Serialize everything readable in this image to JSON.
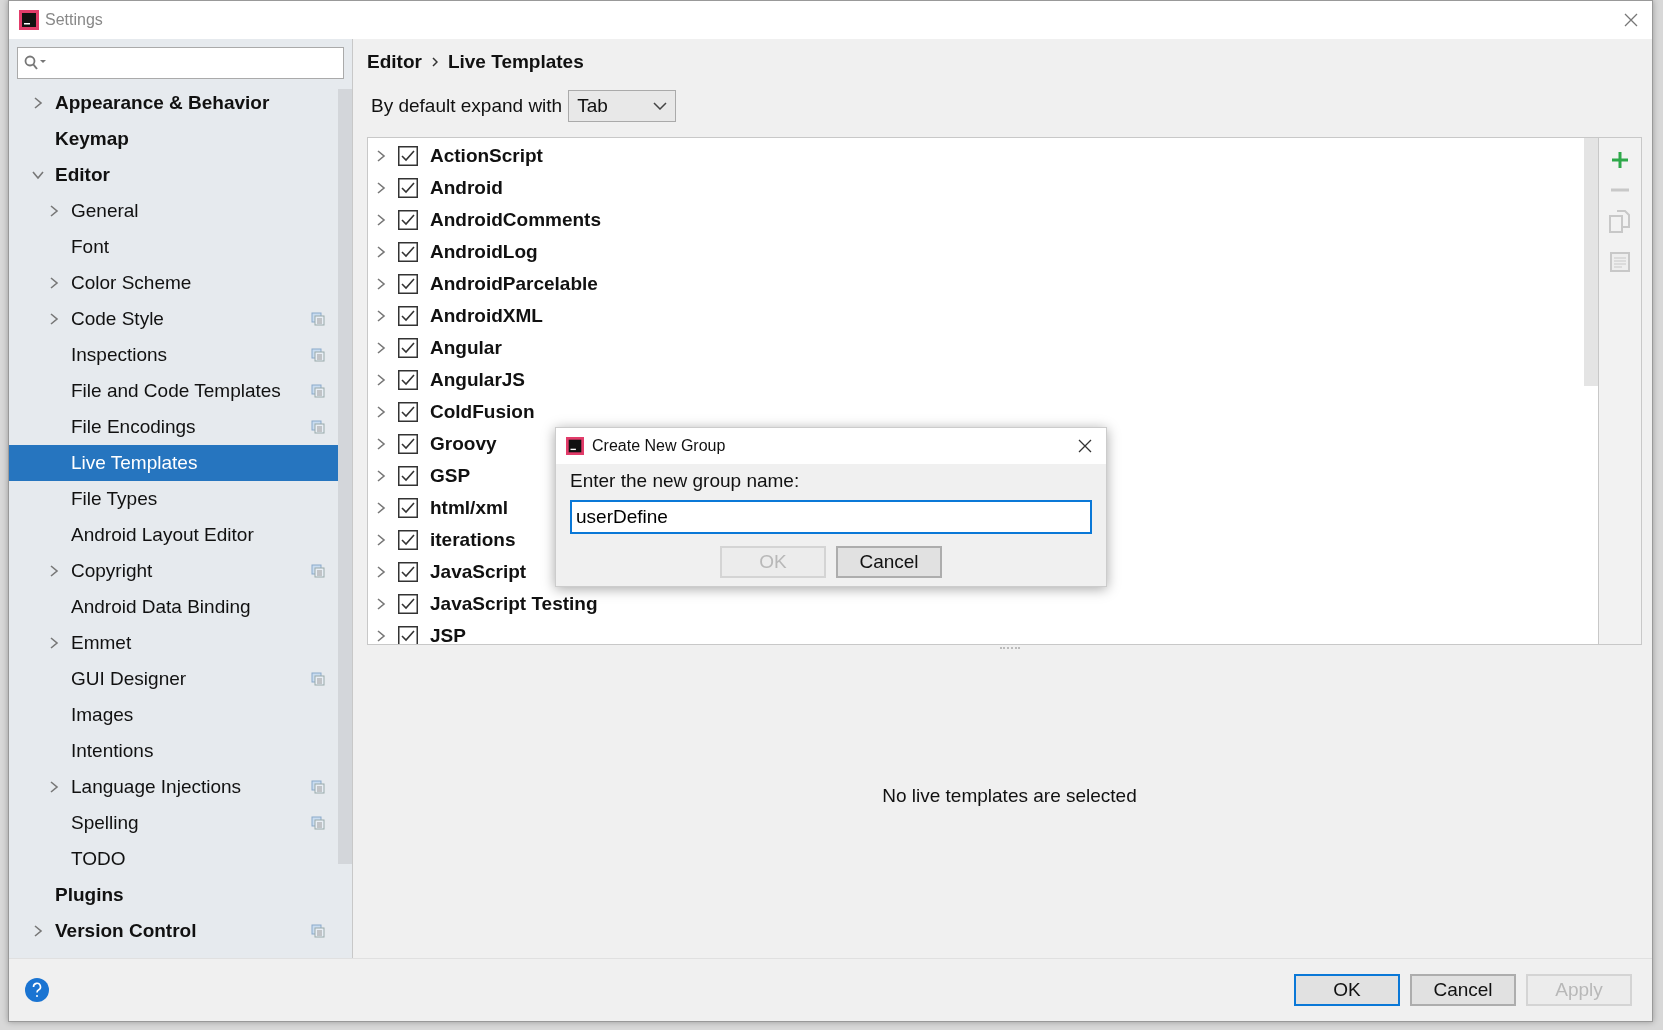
{
  "window": {
    "title": "Settings"
  },
  "sidebar": {
    "items": [
      {
        "label": "Appearance & Behavior",
        "expanded": false,
        "selected": false,
        "project_level": false
      },
      {
        "label": "Keymap",
        "selected": false,
        "project_level": false
      },
      {
        "label": "Editor",
        "expanded": true,
        "selected": false,
        "project_level": false,
        "children": [
          {
            "label": "General",
            "expanded": false,
            "selected": false,
            "project_level": false
          },
          {
            "label": "Font",
            "selected": false,
            "project_level": false
          },
          {
            "label": "Color Scheme",
            "expanded": false,
            "selected": false,
            "project_level": false
          },
          {
            "label": "Code Style",
            "expanded": false,
            "selected": false,
            "project_level": true
          },
          {
            "label": "Inspections",
            "selected": false,
            "project_level": true
          },
          {
            "label": "File and Code Templates",
            "selected": false,
            "project_level": true
          },
          {
            "label": "File Encodings",
            "selected": false,
            "project_level": true
          },
          {
            "label": "Live Templates",
            "selected": true,
            "project_level": false
          },
          {
            "label": "File Types",
            "selected": false,
            "project_level": false
          },
          {
            "label": "Android Layout Editor",
            "selected": false,
            "project_level": false
          },
          {
            "label": "Copyright",
            "expanded": false,
            "selected": false,
            "project_level": true
          },
          {
            "label": "Android Data Binding",
            "selected": false,
            "project_level": false
          },
          {
            "label": "Emmet",
            "expanded": false,
            "selected": false,
            "project_level": false
          },
          {
            "label": "GUI Designer",
            "selected": false,
            "project_level": true
          },
          {
            "label": "Images",
            "selected": false,
            "project_level": false
          },
          {
            "label": "Intentions",
            "selected": false,
            "project_level": false
          },
          {
            "label": "Language Injections",
            "expanded": false,
            "selected": false,
            "project_level": true
          },
          {
            "label": "Spelling",
            "selected": false,
            "project_level": true
          },
          {
            "label": "TODO",
            "selected": false,
            "project_level": false
          }
        ]
      },
      {
        "label": "Plugins",
        "selected": false,
        "project_level": false
      },
      {
        "label": "Version Control",
        "expanded": false,
        "selected": false,
        "project_level": true
      }
    ]
  },
  "breadcrumb": [
    "Editor",
    "Live Templates"
  ],
  "expand_with": {
    "label": "By default expand with",
    "value": "Tab"
  },
  "templates": [
    {
      "name": "ActionScript",
      "checked": true,
      "expanded": false
    },
    {
      "name": "Android",
      "checked": true,
      "expanded": false
    },
    {
      "name": "AndroidComments",
      "checked": true,
      "expanded": false
    },
    {
      "name": "AndroidLog",
      "checked": true,
      "expanded": false
    },
    {
      "name": "AndroidParcelable",
      "checked": true,
      "expanded": false
    },
    {
      "name": "AndroidXML",
      "checked": true,
      "expanded": false
    },
    {
      "name": "Angular",
      "checked": true,
      "expanded": false
    },
    {
      "name": "AngularJS",
      "checked": true,
      "expanded": false
    },
    {
      "name": "ColdFusion",
      "checked": true,
      "expanded": false
    },
    {
      "name": "Groovy",
      "checked": true,
      "expanded": false
    },
    {
      "name": "GSP",
      "checked": true,
      "expanded": false
    },
    {
      "name": "html/xml",
      "checked": true,
      "expanded": false
    },
    {
      "name": "iterations",
      "checked": true,
      "expanded": false
    },
    {
      "name": "JavaScript",
      "checked": true,
      "expanded": false
    },
    {
      "name": "JavaScript Testing",
      "checked": true,
      "expanded": false
    },
    {
      "name": "JSP",
      "checked": true,
      "expanded": false
    }
  ],
  "toolbar": [
    {
      "kind": "add",
      "disabled": false
    },
    {
      "kind": "remove",
      "disabled": true
    },
    {
      "kind": "copy",
      "disabled": true
    },
    {
      "kind": "restore",
      "disabled": true
    }
  ],
  "empty_message": "No live templates are selected",
  "dialog": {
    "title": "Create New Group",
    "prompt": "Enter the new group name:",
    "value": "userDefine",
    "buttons": [
      {
        "label": "OK",
        "disabled": true,
        "default": false
      },
      {
        "label": "Cancel",
        "disabled": false,
        "default": false
      }
    ]
  },
  "buttons": [
    {
      "label": "OK",
      "disabled": false,
      "default": true
    },
    {
      "label": "Cancel",
      "disabled": false,
      "default": false
    },
    {
      "label": "Apply",
      "disabled": true,
      "default": false
    }
  ]
}
